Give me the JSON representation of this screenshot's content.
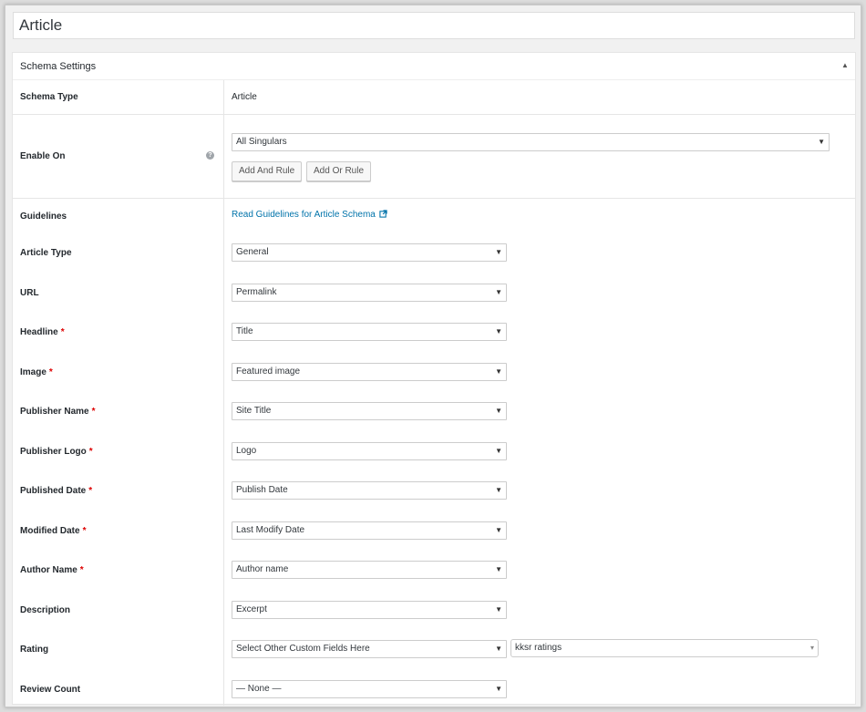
{
  "title_input": {
    "value": "Article"
  },
  "postbox": {
    "title": "Schema Settings",
    "toggle_icon": "triangle-up"
  },
  "schema_type": {
    "label": "Schema Type",
    "value": "Article"
  },
  "enable_on": {
    "label": "Enable On",
    "help_icon": "question-circle",
    "selected": "All Singulars",
    "add_and_rule": "Add And Rule",
    "add_or_rule": "Add Or Rule"
  },
  "guidelines": {
    "label": "Guidelines",
    "link_text": "Read Guidelines for Article Schema",
    "link_icon": "external-link"
  },
  "fields": [
    {
      "label": "Article Type",
      "required": false,
      "selected": "General"
    },
    {
      "label": "URL",
      "required": false,
      "selected": "Permalink"
    },
    {
      "label": "Headline",
      "required": true,
      "selected": "Title"
    },
    {
      "label": "Image",
      "required": true,
      "selected": "Featured image"
    },
    {
      "label": "Publisher Name",
      "required": true,
      "selected": "Site Title"
    },
    {
      "label": "Publisher Logo",
      "required": true,
      "selected": "Logo"
    },
    {
      "label": "Published Date",
      "required": true,
      "selected": "Publish Date"
    },
    {
      "label": "Modified Date",
      "required": true,
      "selected": "Last Modify Date"
    },
    {
      "label": "Author Name",
      "required": true,
      "selected": "Author name"
    },
    {
      "label": "Description",
      "required": false,
      "selected": "Excerpt"
    },
    {
      "label": "Rating",
      "required": false,
      "selected": "Select Other Custom Fields Here",
      "secondary": "kksr ratings"
    },
    {
      "label": "Review Count",
      "required": false,
      "selected": "— None —"
    }
  ],
  "required_marker": "*",
  "colors": {
    "link": "#0073aa",
    "required": "#dd0000",
    "border": "#e5e5e5"
  }
}
